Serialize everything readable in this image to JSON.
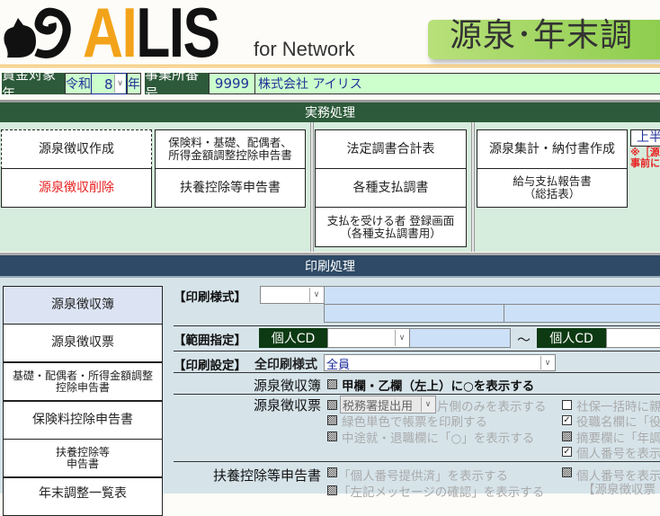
{
  "header": {
    "logo_ai": "AI",
    "logo_lis": "LIS",
    "logo_sub": "for Network",
    "title": "源泉･年末調"
  },
  "infobar": {
    "year_label": "賃金対象年",
    "era": "令和",
    "year": "8",
    "year_suffix": "年",
    "office_label": "事業所番号",
    "office_no": "9999",
    "company": "株式会社 アイリス"
  },
  "jitsumu": {
    "title": "実務処理",
    "buttons": [
      "源泉徴収作成",
      "源泉徴収削除",
      "保険料・基礎、配偶者、\n所得金額調整控除申告書",
      "扶養控除等申告書",
      "法定調書合計表",
      "各種支払調書",
      "支払を受ける者 登録画面\n（各種支払調書用）",
      "源泉集計・納付書作成",
      "給与支払報告書\n（総括表）"
    ],
    "side_button": "上半",
    "note_line1": "※［源",
    "note_line2": "事前に"
  },
  "insatsu": {
    "title": "印刷処理",
    "menu": [
      "源泉徴収簿",
      "源泉徴収票",
      "基礎・配偶者・所得金額調整\n控除申告書",
      "保険料控除申告書",
      "扶養控除等\n申告書",
      "年末調整一覧表"
    ],
    "style_label": "【印刷様式】",
    "range_label": "【範囲指定】",
    "range_from_label": "個人CD",
    "range_tilde": "～",
    "range_to_label": "個人CD",
    "setting_label": "【印刷設定】",
    "all_style_label": "全印刷様式",
    "all_style_value": "全員",
    "boshu_label": "源泉徴収簿",
    "boshu_opt": "甲欄・乙欄（左上）に○を表示する",
    "hyo_label": "源泉徴収票",
    "hyo_select": "税務署提出用",
    "hyo_opts": [
      "片側のみを表示する",
      "緑色単色で帳票を印刷する",
      "中途就・退職欄に「○」を表示する"
    ],
    "hyo_right": [
      "社保一括時に親",
      "役職名欄に「役",
      "摘要欄に「年調",
      "個人番号を表示"
    ],
    "fuyo_label": "扶養控除等申告書",
    "fuyo_opts": [
      "「個人番号提供済」を表示する",
      "「左記メッセージの確認」を表示する"
    ],
    "fuyo_right": "個人番号を表示",
    "fuyo_right_sub": "【源泉徴収票・"
  },
  "colors": {
    "accent_orange": "#f3a31a",
    "dark_green": "#2d5a3a",
    "navy": "#2e4a66",
    "delete_red": "#e82020"
  }
}
